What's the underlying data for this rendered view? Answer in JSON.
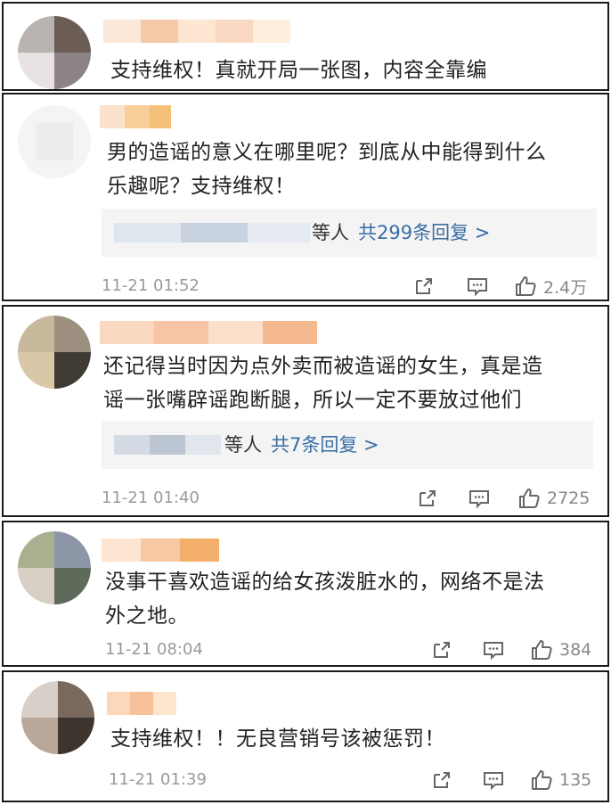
{
  "comments": [
    {
      "text_lines": [
        "支持维权！真就开局一张图，内容全靠编"
      ],
      "avatar_colors": [
        "#b9b4b2",
        "#6b5c56",
        "#e8e3e2",
        "#8c8385"
      ],
      "name_colors": [
        "#fbe8d8",
        "#f6c9a8",
        "#fde6d2",
        "#f9d9c4",
        "#fdeede"
      ]
    },
    {
      "text_lines": [
        "男的造谣的意义在哪里呢？到底从中能得到什么",
        "乐趣呢？支持维权！"
      ],
      "reply_suffix": "等人",
      "reply_link": "共299条回复 >",
      "time": "11-21 01:52",
      "like_count": "2.4万",
      "avatar_colors": [
        "#f2f2f2",
        "#e8e8e8",
        "#f8f8f8",
        "#eaeaea"
      ],
      "name_colors": [
        "#fbe2cc",
        "#f9cf99",
        "#f7c07a"
      ],
      "reply_blur_colors": [
        "#dfe6ee",
        "#c9d3df",
        "#e6ebf1"
      ]
    },
    {
      "text_lines": [
        "还记得当时因为点外卖而被造谣的女生，真是造",
        "谣一张嘴辟谣跑断腿，所以一定不要放过他们"
      ],
      "reply_suffix": "等人",
      "reply_link": "共7条回复 >",
      "time": "11-21 01:40",
      "like_count": "2725",
      "avatar_colors": [
        "#c8b89c",
        "#6b604e",
        "#d9c8a8",
        "#3f3a33"
      ],
      "name_colors": [
        "#fad7c0",
        "#f7c5a5",
        "#fbe0cc",
        "#f5b98f"
      ],
      "reply_blur_colors": [
        "#d4dbe4",
        "#bcc6d3",
        "#e1e6ec"
      ]
    },
    {
      "text_lines": [
        "没事干喜欢造谣的给女孩泼脏水的，网络不是法",
        "外之地。"
      ],
      "time": "11-21 08:04",
      "like_count": "384",
      "avatar_colors": [
        "#a9b08f",
        "#8d96a6",
        "#d7cfc4",
        "#5e6a5a"
      ],
      "name_colors": [
        "#fde5d2",
        "#f6c8a3",
        "#f4b06a"
      ]
    },
    {
      "text_lines": [
        "支持维权！！无良营销号该被惩罚！"
      ],
      "time": "11-21 01:39",
      "like_count": "135",
      "avatar_colors": [
        "#d8cfc8",
        "#7a6a5e",
        "#b9a89a",
        "#3e342e"
      ],
      "name_colors": [
        "#fcd7b9",
        "#f7c29a",
        "#fde5d0"
      ]
    }
  ],
  "icons": {
    "share": "share-icon",
    "comment": "comment-icon",
    "like": "thumb-up-icon"
  }
}
